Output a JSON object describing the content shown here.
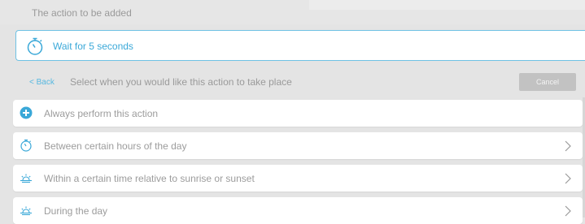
{
  "section": {
    "label": "The action to be added"
  },
  "selected_action": {
    "label": "Wait for 5 seconds",
    "icon": "stopwatch-icon"
  },
  "nav": {
    "back_label": "< Back",
    "prompt": "Select when you would like this action to take place",
    "cancel_label": "Cancel"
  },
  "options": [
    {
      "label": "Always perform this action",
      "icon": "plus-circle-icon"
    },
    {
      "label": "Between certain hours of the day",
      "icon": "stopwatch-icon"
    },
    {
      "label": "Within a certain time relative to sunrise or sunset",
      "icon": "sunrise-icon"
    },
    {
      "label": "During the day",
      "icon": "sunrise-icon"
    }
  ],
  "colors": {
    "accent": "#3aa8d8",
    "background": "#e4e4e4",
    "card": "#ffffff",
    "muted_text": "#9c9c9c"
  }
}
